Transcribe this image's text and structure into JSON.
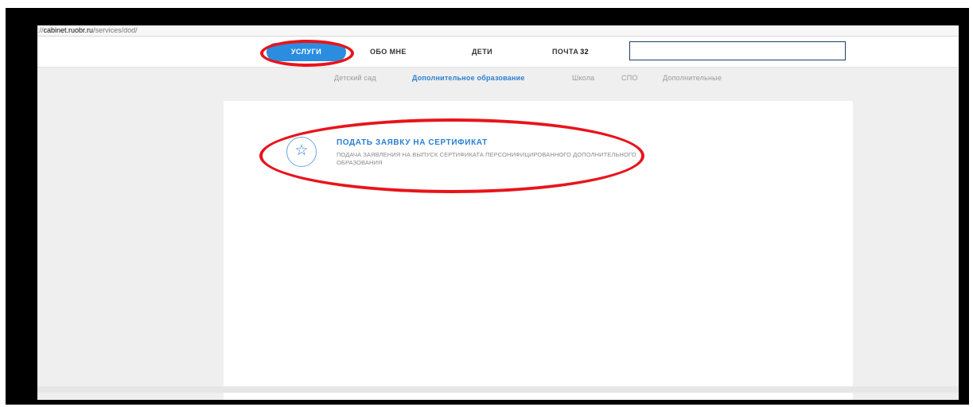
{
  "browser": {
    "url_scheme": "://",
    "url_domain": "cabinet.ruobr.ru",
    "url_path": "/services/dod/"
  },
  "topnav": {
    "services_label": "УСЛУГИ",
    "about_label": "ОБО МНЕ",
    "children_label": "ДЕТИ",
    "mail_label": "ПОЧТА",
    "mail_count": "32",
    "search_value": ""
  },
  "subnav": {
    "items": [
      "Детский сад",
      "Дополнительное образование",
      "Школа",
      "СПО",
      "Дополнительные"
    ],
    "active_index": 1
  },
  "service": {
    "icon": "star-icon",
    "title": "ПОДАТЬ ЗАЯВКУ НА СЕРТИФИКАТ",
    "description": "ПОДАЧА ЗАЯВЛЕНИЯ НА ВЫПУСК СЕРТИФИКАТА ПЕРСОНИФИЦИРОВАННОГО ДОПОЛНИТЕЛЬНОГО ОБРАЗОВАНИЯ"
  },
  "colors": {
    "accent": "#2b8de0",
    "annotation": "#e8141b",
    "search_border": "#1f3d66"
  }
}
